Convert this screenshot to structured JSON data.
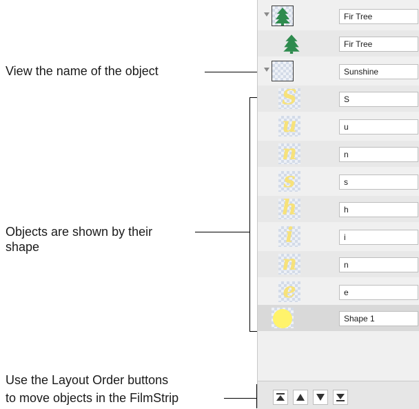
{
  "callouts": {
    "view_name": "View the name of the object",
    "shapes_line1": "Objects are shown by their",
    "shapes_line2": "shape",
    "layout_line1": "Use the Layout Order buttons",
    "layout_line2": "to move objects in the FilmStrip"
  },
  "filmstrip": {
    "rows": [
      {
        "name": "Fir Tree",
        "thumb": "fir-tree-icon",
        "kind": "group"
      },
      {
        "name": "Fir Tree",
        "thumb": "fir-tree-icon",
        "kind": "child"
      },
      {
        "name": "Sunshine",
        "thumb": "empty-group-thumbnail",
        "kind": "group"
      },
      {
        "name": "S",
        "letter": "S"
      },
      {
        "name": "u",
        "letter": "u"
      },
      {
        "name": "n",
        "letter": "n"
      },
      {
        "name": "s",
        "letter": "s"
      },
      {
        "name": "h",
        "letter": "h"
      },
      {
        "name": "i",
        "letter": "i"
      },
      {
        "name": "n",
        "letter": "n"
      },
      {
        "name": "e",
        "letter": "e"
      },
      {
        "name": "Shape 1",
        "thumb": "yellow-circle-icon"
      }
    ]
  },
  "toolbar": {
    "buttons": [
      "move-to-top-icon",
      "move-up-icon",
      "move-down-icon",
      "move-to-bottom-icon"
    ]
  },
  "colors": {
    "tree_green": "#2e8b4e",
    "letter_yellow": "#f7e27a",
    "circle_yellow": "#fff36b"
  }
}
